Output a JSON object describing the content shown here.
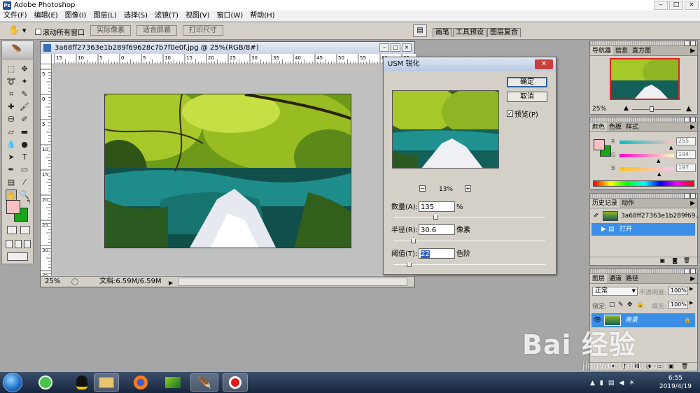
{
  "app": {
    "title": "Adobe Photoshop"
  },
  "menu": [
    "文件(F)",
    "编辑(E)",
    "图像(I)",
    "图层(L)",
    "选择(S)",
    "滤镜(T)",
    "视图(V)",
    "窗口(W)",
    "帮助(H)"
  ],
  "options": {
    "scroll_all_label": "滚动所有窗口",
    "actual_pixels": "实际像素",
    "fit_screen": "适合屏幕",
    "print_size": "打印尺寸"
  },
  "palette_well": [
    "画笔",
    "工具预设",
    "图层复合"
  ],
  "document": {
    "title": "3a68ff27363e1b289f69628c7b7f0e0f.jpg @ 25%(RGB/8#)",
    "zoom": "25%",
    "doc_info": "文档:6.59M/6.59M",
    "ruler_h": [
      "15",
      "10",
      "5",
      "0",
      "5",
      "10",
      "15",
      "20",
      "25",
      "30",
      "35",
      "40",
      "45",
      "50",
      "55",
      "60",
      "65"
    ],
    "ruler_v": [
      "5",
      "0",
      "5",
      "10",
      "15",
      "20",
      "25",
      "30",
      "35"
    ]
  },
  "usm": {
    "title": "USM 锐化",
    "ok": "确定",
    "cancel": "取消",
    "preview_label": "预览(P)",
    "preview_checked": true,
    "zoom": "13%",
    "amount_label": "数量(A):",
    "amount_value": "135",
    "amount_unit": "%",
    "amount_level": 0.27,
    "radius_label": "半径(R):",
    "radius_value": "30.6",
    "radius_unit": "像素",
    "radius_level": 0.12,
    "threshold_label": "阈值(T):",
    "threshold_value": "22",
    "threshold_unit": "色阶",
    "threshold_level": 0.09
  },
  "navigator": {
    "tabs": [
      "导航器",
      "信息",
      "直方图"
    ],
    "zoom": "25%"
  },
  "color": {
    "tabs": [
      "颜色",
      "色板",
      "样式"
    ],
    "r": {
      "label": "R",
      "value": "255",
      "level": 1.0
    },
    "g": {
      "label": "G",
      "value": "194",
      "level": 0.76
    },
    "b": {
      "label": "B",
      "value": "197",
      "level": 0.77
    },
    "fg": "#f7c1c3",
    "bg": "#19a51a"
  },
  "history": {
    "tabs": [
      "历史记录",
      "动作"
    ],
    "snapshot": "3a68ff27363e1b289f69...",
    "state": "打开"
  },
  "layers": {
    "tabs": [
      "图层",
      "通道",
      "路径"
    ],
    "blend": "正常",
    "opacity_label": "不透明度:",
    "opacity": "100%",
    "lock_label": "锁定:",
    "fill_label": "填充:",
    "fill": "100%",
    "layer_name": "背景"
  },
  "taskbar": {
    "time": "6:55",
    "date": "2019/4/19"
  },
  "watermark": {
    "brand": "Bai 经验",
    "url": "jingyan.baidu.com"
  }
}
